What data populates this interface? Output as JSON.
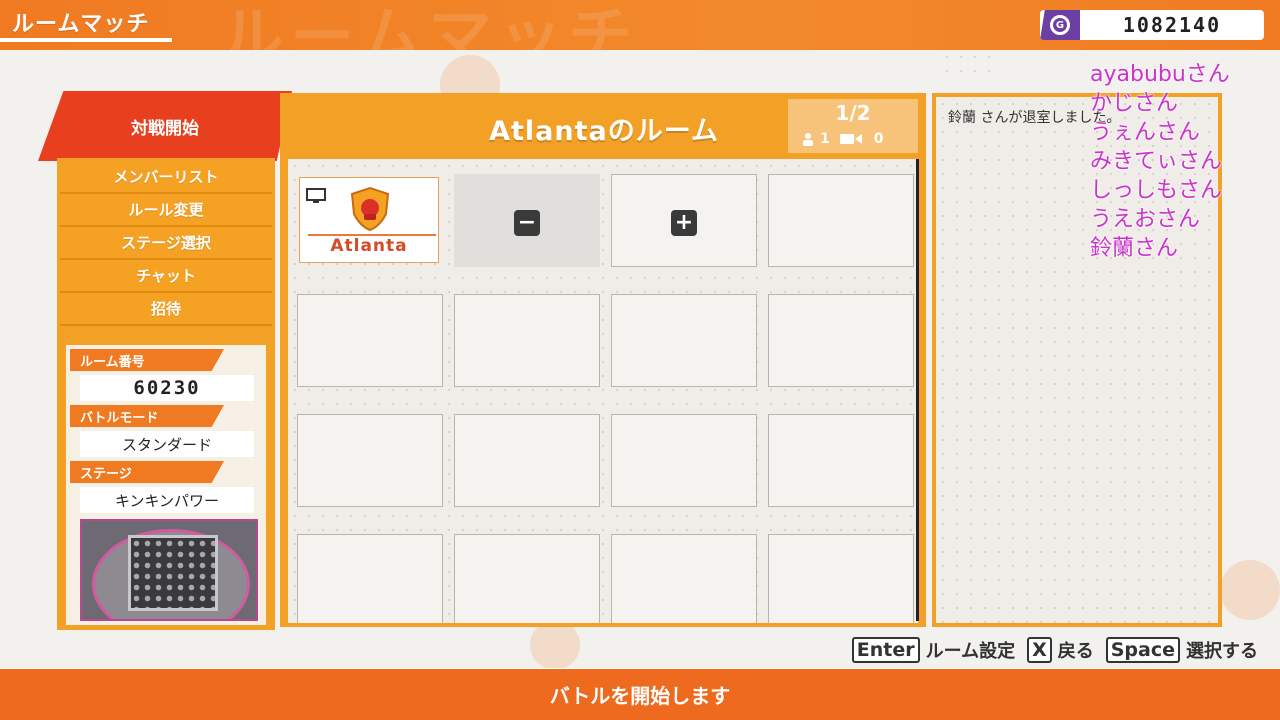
{
  "header": {
    "title": "ルームマッチ",
    "currency": "1082140"
  },
  "left_menu": {
    "start_label": "対戦開始",
    "items": [
      {
        "label": "メンバーリスト"
      },
      {
        "label": "ルール変更"
      },
      {
        "label": "ステージ選択"
      },
      {
        "label": "チャット"
      },
      {
        "label": "招待"
      }
    ]
  },
  "room_info": {
    "room_number_label": "ルーム番号",
    "room_number": "60230",
    "battle_mode_label": "バトルモード",
    "battle_mode": "スタンダード",
    "stage_label": "ステージ",
    "stage": "キンキンパワー"
  },
  "room": {
    "title": "Atlantaのルーム",
    "count": "1/2",
    "players": "1",
    "spectators": "0",
    "host_name": "Atlanta",
    "minus_symbol": "−",
    "plus_symbol": "+"
  },
  "chat": {
    "message": "鈴蘭 さんが退室しました。"
  },
  "overlay_comments": [
    "ayabubuさん",
    "かじさん",
    "うぇんさん",
    "みきてぃさん",
    "しっしもさん",
    "うえおさん",
    "鈴蘭さん"
  ],
  "hints": {
    "enter_key": "Enter",
    "enter_label": "ルーム設定",
    "x_key": "X",
    "x_label": "戻る",
    "space_key": "Space",
    "space_label": "選択する"
  },
  "footer": {
    "message": "バトルを開始します"
  },
  "colors": {
    "accent_orange": "#f07a22",
    "panel_orange": "#f3a126",
    "start_red": "#e8401e",
    "comment_magenta": "#cc33cc",
    "coin_purple": "#6c3fa5"
  }
}
